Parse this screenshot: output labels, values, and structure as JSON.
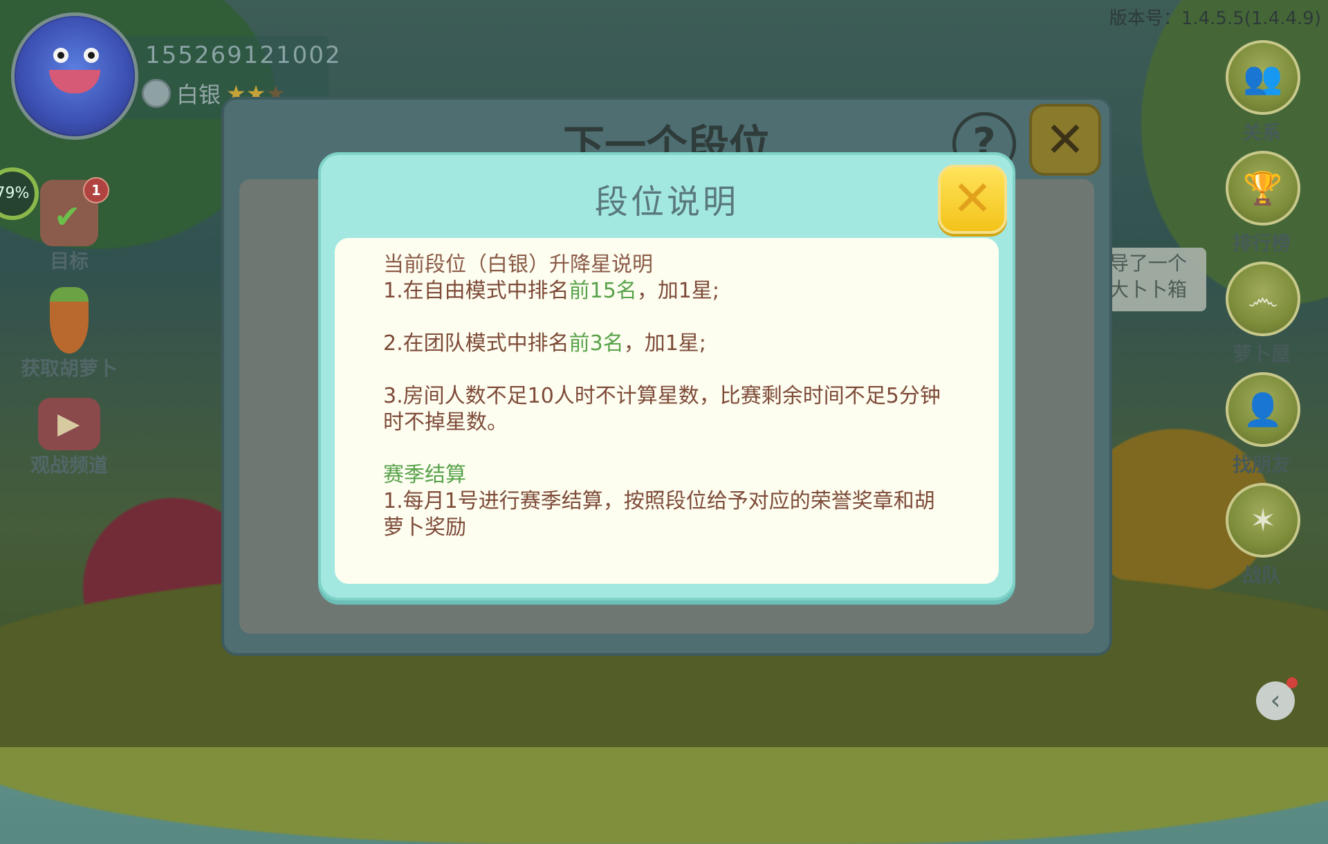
{
  "version": "版本号：1.4.5.5(1.4.4.9)",
  "profile": {
    "user_id": "155269121002",
    "rank_name": "白银",
    "stars_filled": 2,
    "stars_total": 3
  },
  "left_menu": {
    "target_label": "目标",
    "target_badge": "1",
    "progress_text": "79%",
    "carrot_label": "获取胡萝卜",
    "watch_label": "观战频道"
  },
  "right_menu": {
    "relations_label": "关系",
    "ranking_label": "排行榜",
    "house_label": "萝卜屋",
    "find_friends_label": "找朋友",
    "team_label": "战队"
  },
  "tooltip_text": "导了一个大卜卜箱",
  "back_panel": {
    "title": "下一个段位",
    "help_icon": "?"
  },
  "modal": {
    "title": "段位说明",
    "section1_title": "当前段位（白银）升降星说明",
    "rule1_a": "1.在自由模式中排名",
    "rule1_hl": "前15名",
    "rule1_b": "，加1星;",
    "rule2_a": "2.在团队模式中排名",
    "rule2_hl": "前3名",
    "rule2_b": "，加1星;",
    "rule3": "3.房间人数不足10人时不计算星数，比赛剩余时间不足5分钟时不掉星数。",
    "section2_title": "赛季结算",
    "season1": "1.每月1号进行赛季结算，按照段位给予对应的荣誉奖章和胡萝卜奖励"
  },
  "colors": {
    "modal_bg": "#a3e8e0",
    "content_bg": "#fdfdf0",
    "text_brown": "#7d4a37",
    "highlight_green": "#58a24a",
    "close_yellow": "#f3c31a"
  }
}
